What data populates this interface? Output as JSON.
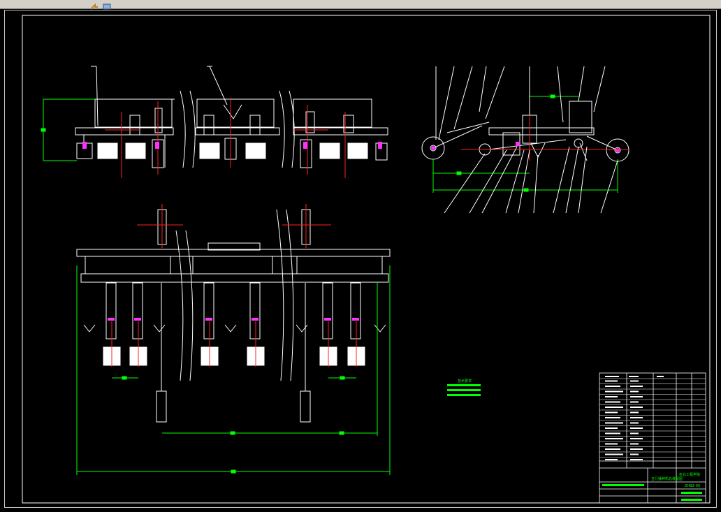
{
  "window": {
    "toolbar_icons": [
      "arrow-icon",
      "layers-icon"
    ]
  },
  "colors": {
    "background": "#000000",
    "line": "#ffffff",
    "dimension": "#00ff00",
    "center": "#ff0000",
    "highlight": "#ff00ff"
  },
  "tech_requirements": {
    "heading": "技术要求"
  },
  "title_block": {
    "drawing_name": "五行播种机总装配图",
    "school": "农业工程学院",
    "drawing_no": "ZHBZ-00"
  }
}
